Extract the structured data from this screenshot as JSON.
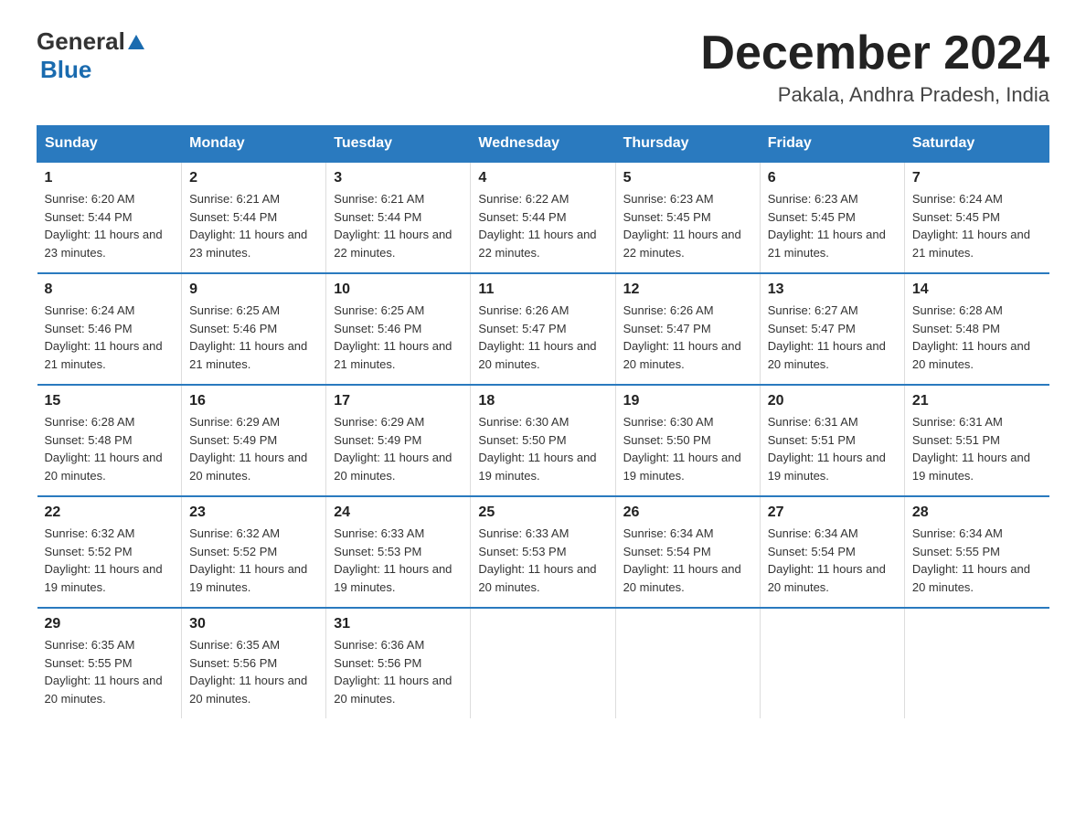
{
  "header": {
    "logo_general": "General",
    "logo_blue": "Blue",
    "title": "December 2024",
    "location": "Pakala, Andhra Pradesh, India"
  },
  "days_of_week": [
    "Sunday",
    "Monday",
    "Tuesday",
    "Wednesday",
    "Thursday",
    "Friday",
    "Saturday"
  ],
  "weeks": [
    [
      {
        "date": "1",
        "sunrise": "6:20 AM",
        "sunset": "5:44 PM",
        "daylight": "11 hours and 23 minutes."
      },
      {
        "date": "2",
        "sunrise": "6:21 AM",
        "sunset": "5:44 PM",
        "daylight": "11 hours and 23 minutes."
      },
      {
        "date": "3",
        "sunrise": "6:21 AM",
        "sunset": "5:44 PM",
        "daylight": "11 hours and 22 minutes."
      },
      {
        "date": "4",
        "sunrise": "6:22 AM",
        "sunset": "5:44 PM",
        "daylight": "11 hours and 22 minutes."
      },
      {
        "date": "5",
        "sunrise": "6:23 AM",
        "sunset": "5:45 PM",
        "daylight": "11 hours and 22 minutes."
      },
      {
        "date": "6",
        "sunrise": "6:23 AM",
        "sunset": "5:45 PM",
        "daylight": "11 hours and 21 minutes."
      },
      {
        "date": "7",
        "sunrise": "6:24 AM",
        "sunset": "5:45 PM",
        "daylight": "11 hours and 21 minutes."
      }
    ],
    [
      {
        "date": "8",
        "sunrise": "6:24 AM",
        "sunset": "5:46 PM",
        "daylight": "11 hours and 21 minutes."
      },
      {
        "date": "9",
        "sunrise": "6:25 AM",
        "sunset": "5:46 PM",
        "daylight": "11 hours and 21 minutes."
      },
      {
        "date": "10",
        "sunrise": "6:25 AM",
        "sunset": "5:46 PM",
        "daylight": "11 hours and 21 minutes."
      },
      {
        "date": "11",
        "sunrise": "6:26 AM",
        "sunset": "5:47 PM",
        "daylight": "11 hours and 20 minutes."
      },
      {
        "date": "12",
        "sunrise": "6:26 AM",
        "sunset": "5:47 PM",
        "daylight": "11 hours and 20 minutes."
      },
      {
        "date": "13",
        "sunrise": "6:27 AM",
        "sunset": "5:47 PM",
        "daylight": "11 hours and 20 minutes."
      },
      {
        "date": "14",
        "sunrise": "6:28 AM",
        "sunset": "5:48 PM",
        "daylight": "11 hours and 20 minutes."
      }
    ],
    [
      {
        "date": "15",
        "sunrise": "6:28 AM",
        "sunset": "5:48 PM",
        "daylight": "11 hours and 20 minutes."
      },
      {
        "date": "16",
        "sunrise": "6:29 AM",
        "sunset": "5:49 PM",
        "daylight": "11 hours and 20 minutes."
      },
      {
        "date": "17",
        "sunrise": "6:29 AM",
        "sunset": "5:49 PM",
        "daylight": "11 hours and 20 minutes."
      },
      {
        "date": "18",
        "sunrise": "6:30 AM",
        "sunset": "5:50 PM",
        "daylight": "11 hours and 19 minutes."
      },
      {
        "date": "19",
        "sunrise": "6:30 AM",
        "sunset": "5:50 PM",
        "daylight": "11 hours and 19 minutes."
      },
      {
        "date": "20",
        "sunrise": "6:31 AM",
        "sunset": "5:51 PM",
        "daylight": "11 hours and 19 minutes."
      },
      {
        "date": "21",
        "sunrise": "6:31 AM",
        "sunset": "5:51 PM",
        "daylight": "11 hours and 19 minutes."
      }
    ],
    [
      {
        "date": "22",
        "sunrise": "6:32 AM",
        "sunset": "5:52 PM",
        "daylight": "11 hours and 19 minutes."
      },
      {
        "date": "23",
        "sunrise": "6:32 AM",
        "sunset": "5:52 PM",
        "daylight": "11 hours and 19 minutes."
      },
      {
        "date": "24",
        "sunrise": "6:33 AM",
        "sunset": "5:53 PM",
        "daylight": "11 hours and 19 minutes."
      },
      {
        "date": "25",
        "sunrise": "6:33 AM",
        "sunset": "5:53 PM",
        "daylight": "11 hours and 20 minutes."
      },
      {
        "date": "26",
        "sunrise": "6:34 AM",
        "sunset": "5:54 PM",
        "daylight": "11 hours and 20 minutes."
      },
      {
        "date": "27",
        "sunrise": "6:34 AM",
        "sunset": "5:54 PM",
        "daylight": "11 hours and 20 minutes."
      },
      {
        "date": "28",
        "sunrise": "6:34 AM",
        "sunset": "5:55 PM",
        "daylight": "11 hours and 20 minutes."
      }
    ],
    [
      {
        "date": "29",
        "sunrise": "6:35 AM",
        "sunset": "5:55 PM",
        "daylight": "11 hours and 20 minutes."
      },
      {
        "date": "30",
        "sunrise": "6:35 AM",
        "sunset": "5:56 PM",
        "daylight": "11 hours and 20 minutes."
      },
      {
        "date": "31",
        "sunrise": "6:36 AM",
        "sunset": "5:56 PM",
        "daylight": "11 hours and 20 minutes."
      },
      null,
      null,
      null,
      null
    ]
  ]
}
